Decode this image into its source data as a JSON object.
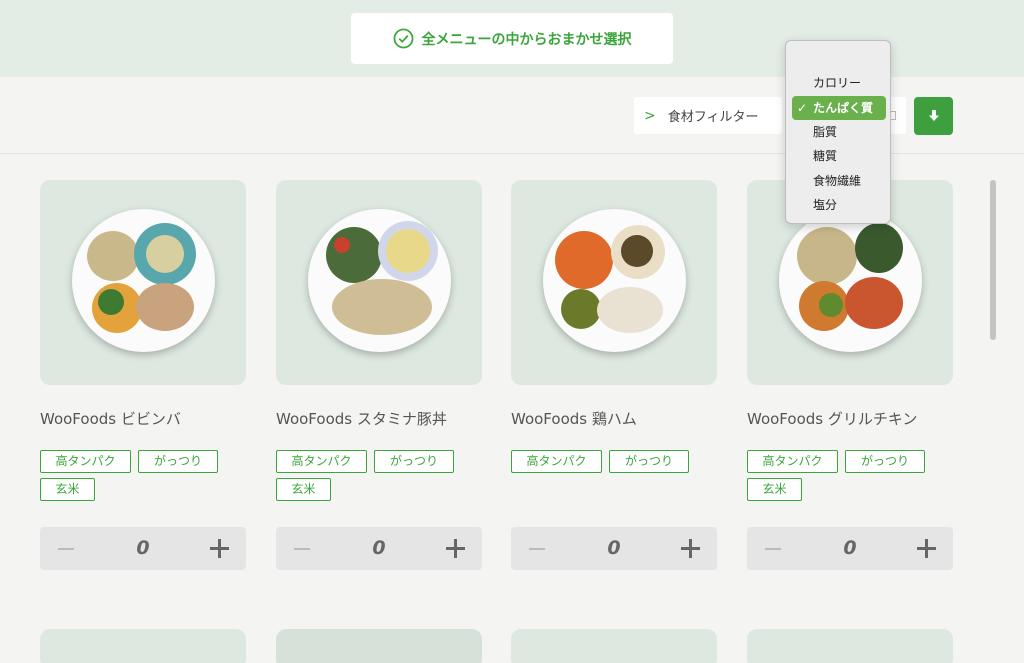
{
  "omakase": {
    "label": "全メニューの中からおまかせ選択",
    "icon": "check-circle-icon"
  },
  "toolbar": {
    "filter_label": "食材フィルター",
    "filter_icon": "chevron-right-icon",
    "download_icon": "download-icon"
  },
  "sort_dropdown": {
    "options": [
      "カロリー",
      "たんぱく質",
      "脂質",
      "糖質",
      "食物繊維",
      "塩分"
    ],
    "selected": "たんぱく質",
    "check_mark": "✓"
  },
  "menu_items": [
    {
      "name": "WooFoods ビビンバ",
      "tags": [
        "高タンパク",
        "がっつり",
        "玄米"
      ],
      "quantity": "0"
    },
    {
      "name": "WooFoods スタミナ豚丼",
      "tags": [
        "高タンパク",
        "がっつり",
        "玄米"
      ],
      "quantity": "0"
    },
    {
      "name": "WooFoods 鶏ハム",
      "tags": [
        "高タンパク",
        "がっつり"
      ],
      "quantity": "0"
    },
    {
      "name": "WooFoods グリルチキン",
      "tags": [
        "高タンパク",
        "がっつり",
        "玄米"
      ],
      "quantity": "0"
    }
  ],
  "colors": {
    "accent": "#3aa53a",
    "card_bg": "#dde9e0",
    "top_band": "#e3ece5"
  }
}
